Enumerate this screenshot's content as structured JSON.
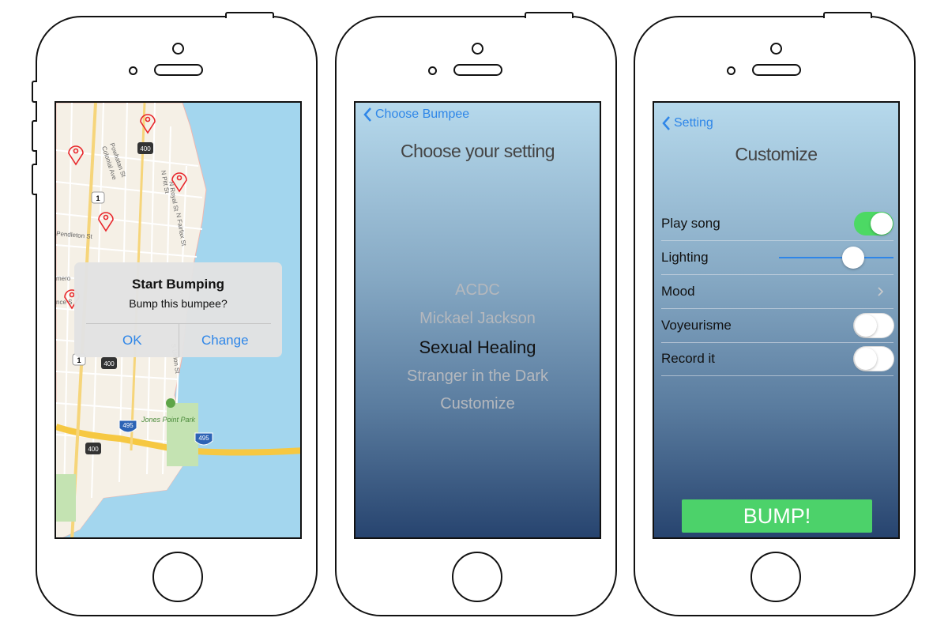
{
  "colors": {
    "accent": "#2e86e8",
    "toggle_on": "#4cd964",
    "bump_button": "#4cd26a",
    "pin": "#e8262b",
    "water": "#a3d6ee",
    "land": "#f5f0e6"
  },
  "map_screen": {
    "labels": {
      "pendleton": "Pendleton St",
      "powhatan": "Powhatan St",
      "colonial": "Colonial Ave",
      "pitt": "N Pitt St",
      "royal": "N Royal St",
      "fairfax": "N Fairfax St",
      "union": "S Union St",
      "park": "Jones Point Park",
      "pomeroy": "mero",
      "fragment": "nce S"
    },
    "shields": {
      "r400": "400",
      "r1": "1",
      "i495": "495"
    },
    "alert": {
      "title": "Start Bumping",
      "message": "Bump this bumpee?",
      "ok": "OK",
      "change": "Change"
    }
  },
  "setting_screen": {
    "back_label": "Choose Bumpee",
    "title": "Choose your setting",
    "options": [
      "ACDC",
      "Mickael Jackson",
      "Sexual Healing",
      "Stranger in the Dark",
      "Customize"
    ],
    "selected": "Sexual Healing"
  },
  "customize_screen": {
    "back_label": "Setting",
    "title": "Customize",
    "rows": [
      {
        "label": "Play song",
        "control": "toggle",
        "on": true
      },
      {
        "label": "Lighting",
        "control": "slider",
        "value": 0.68
      },
      {
        "label": "Mood",
        "control": "disclosure"
      },
      {
        "label": "Voyeurisme",
        "control": "toggle",
        "on": false
      },
      {
        "label": "Record it",
        "control": "toggle",
        "on": false
      }
    ],
    "bump_label": "BUMP!"
  }
}
